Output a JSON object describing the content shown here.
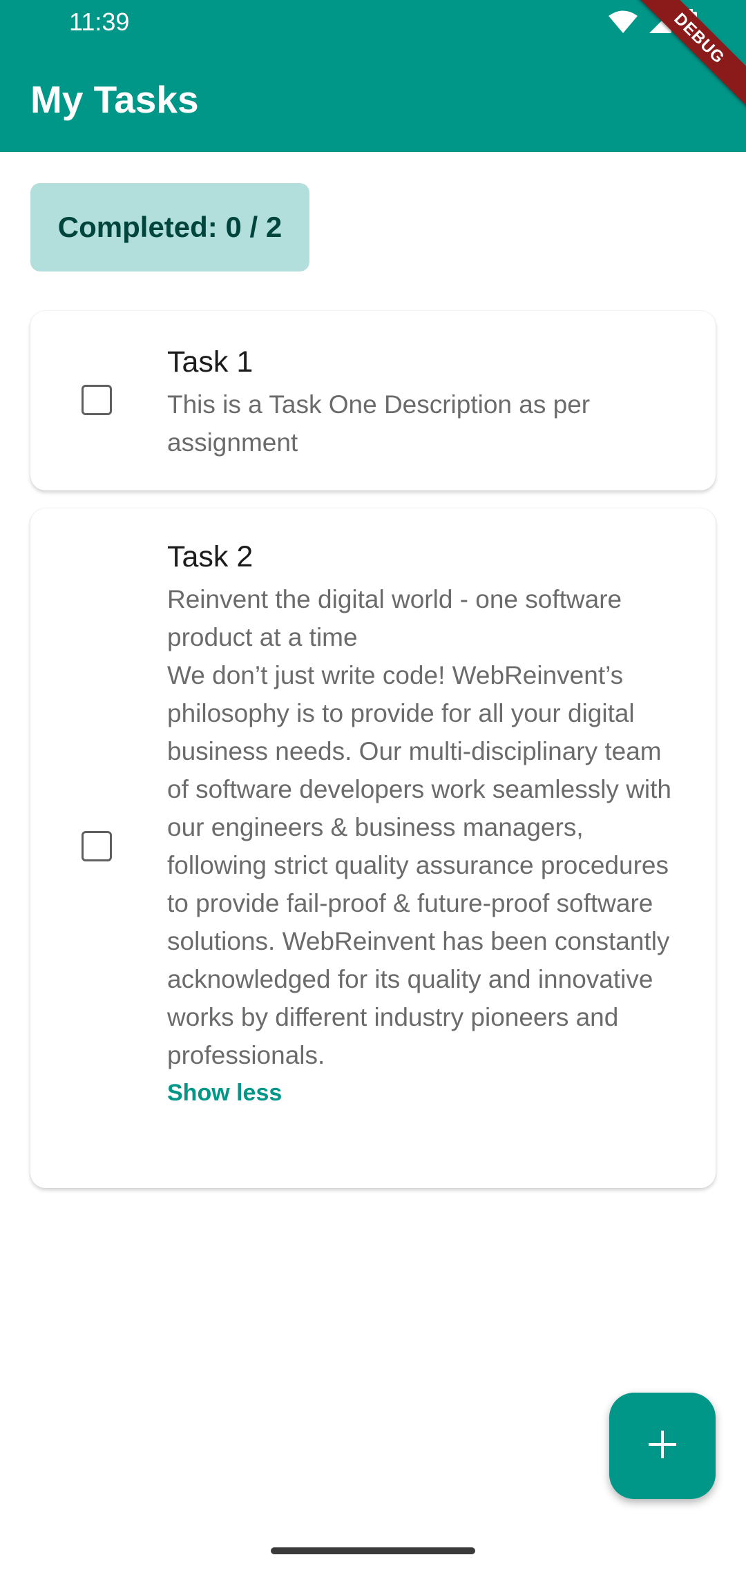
{
  "status_bar": {
    "time": "11:39",
    "icons": [
      "wifi-icon",
      "signal-icon",
      "battery-icon"
    ]
  },
  "app_bar": {
    "title": "My Tasks",
    "debug_label": "DEBUG"
  },
  "summary": {
    "completed_text": "Completed: 0 / 2",
    "completed": 0,
    "total": 2
  },
  "tasks": [
    {
      "title": "Task 1",
      "description": "This is a Task One Description as per assignment",
      "checked": false
    },
    {
      "title": "Task 2",
      "description": "Reinvent the digital world - one software product at a time\nWe don’t just write code! WebReinvent’s philosophy is to provide for all your digital business needs. Our multi-disciplinary team of software developers work seamlessly with our engineers & business managers, following strict quality assurance procedures to provide fail-proof & future-proof software solutions. WebReinvent has been constantly acknowledged for its quality and innovative works by different industry pioneers and professionals.",
      "checked": false,
      "toggle_label": "Show less"
    }
  ],
  "fab": {
    "icon": "add-icon"
  },
  "colors": {
    "primary": "#009688",
    "chip_background": "#b2dfdb",
    "chip_text": "#00453d",
    "debug_banner": "#8b1a1a"
  }
}
